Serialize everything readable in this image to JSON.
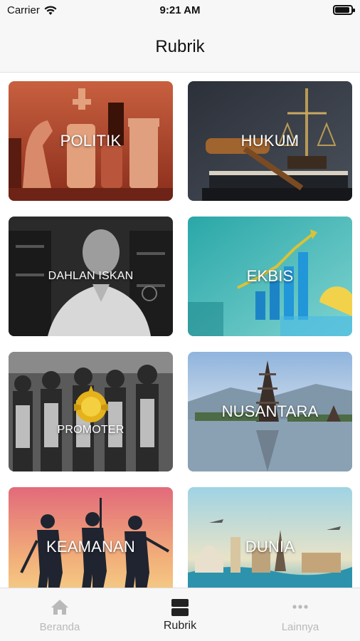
{
  "status_bar": {
    "carrier": "Carrier",
    "time": "9:21 AM",
    "battery_level": 0.9
  },
  "nav": {
    "title": "Rubrik"
  },
  "categories": [
    {
      "label": "POLITIK"
    },
    {
      "label": "HUKUM"
    },
    {
      "label": "DAHLAN ISKAN"
    },
    {
      "label": "EKBIS"
    },
    {
      "label": "PROMOTER"
    },
    {
      "label": "NUSANTARA"
    },
    {
      "label": "KEAMANAN"
    },
    {
      "label": "DUNIA"
    }
  ],
  "tabs": [
    {
      "label": "Beranda",
      "icon": "home-icon",
      "active": false
    },
    {
      "label": "Rubrik",
      "icon": "rubrik-icon",
      "active": true
    },
    {
      "label": "Lainnya",
      "icon": "more-icon",
      "active": false
    }
  ],
  "colors": {
    "active_tab": "#222222",
    "inactive_tab": "#b9b9b9",
    "bar_background": "#f7f7f7"
  }
}
